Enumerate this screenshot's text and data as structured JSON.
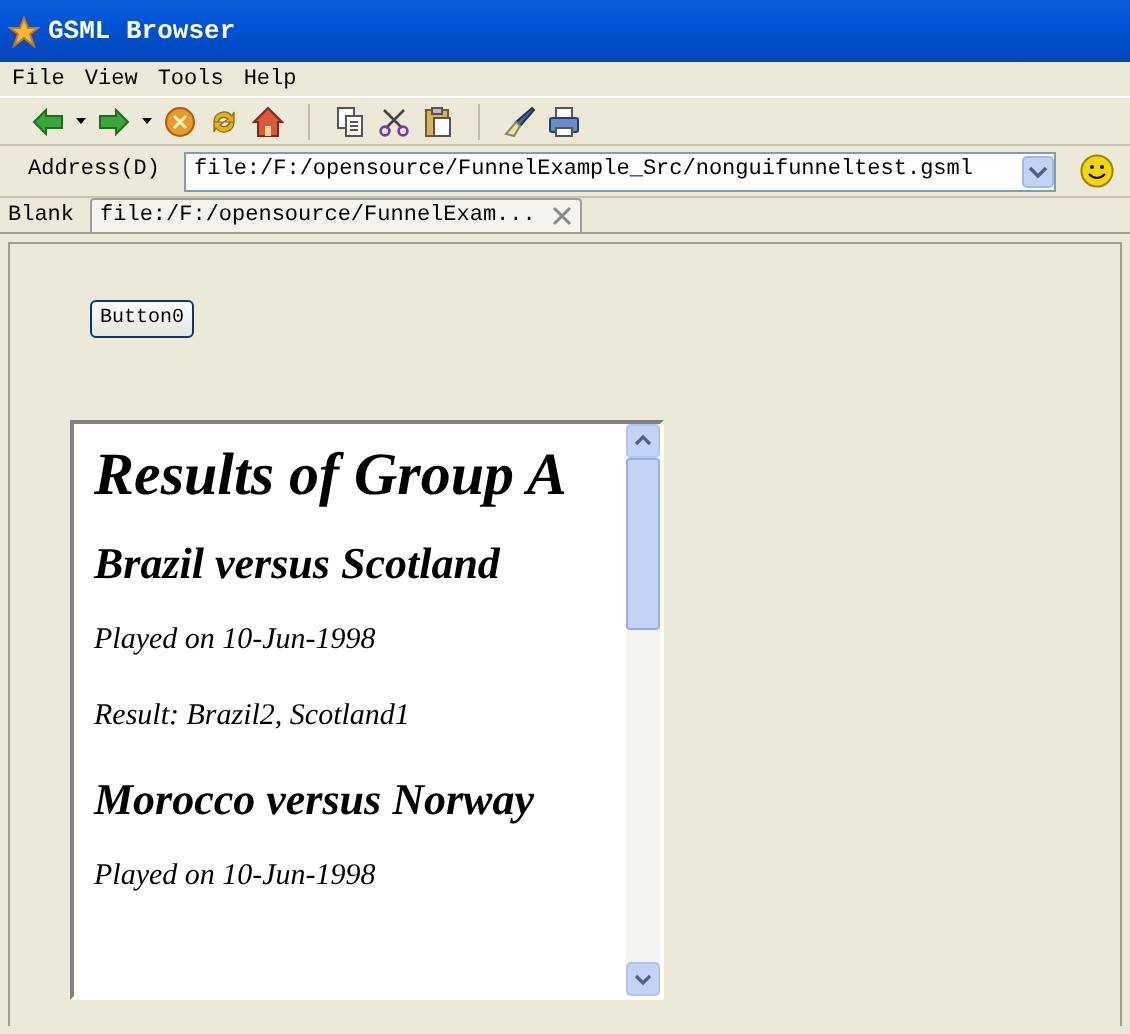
{
  "window": {
    "title": "GSML Browser"
  },
  "menu": [
    "File",
    "View",
    "Tools",
    "Help"
  ],
  "address": {
    "label": "Address(D)",
    "value": "file:/F:/opensource/FunnelExample_Src/nonguifunneltest.gsml"
  },
  "tabs": [
    {
      "label": "Blank",
      "selected": false,
      "closable": false
    },
    {
      "label": "file:/F:/opensource/FunnelExam...",
      "selected": true,
      "closable": true
    }
  ],
  "page": {
    "button": "Button0",
    "content": [
      {
        "kind": "h1",
        "text": "Results of Group A"
      },
      {
        "kind": "h2",
        "text": "Brazil versus Scotland"
      },
      {
        "kind": "p",
        "text": "Played on 10-Jun-1998"
      },
      {
        "kind": "p",
        "text": "Result: Brazil2, Scotland1"
      },
      {
        "kind": "h2",
        "text": "Morocco versus Norway"
      },
      {
        "kind": "p",
        "text": "Played on 10-Jun-1998"
      }
    ]
  }
}
